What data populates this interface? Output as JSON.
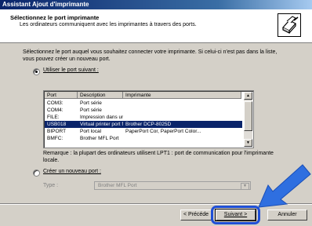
{
  "window": {
    "title": "Assistant Ajout d'imprimante"
  },
  "header": {
    "title": "Sélectionnez le port imprimante",
    "subtitle": "Les ordinateurs communiquent avec les imprimantes à travers des ports."
  },
  "instructions": "Sélectionnez le port auquel vous souhaitez connecter votre imprimante. Si celui-ci n'est pas dans la liste, vous pouvez créer un nouveau port.",
  "use_port": {
    "label": "Utiliser le port suivant :",
    "selected": true
  },
  "port_list": {
    "columns": [
      "Port",
      "Description",
      "Imprimante"
    ],
    "rows": [
      {
        "port": "COM3:",
        "description": "Port série",
        "printer": "",
        "selected": false
      },
      {
        "port": "COM4:",
        "description": "Port série",
        "printer": "",
        "selected": false
      },
      {
        "port": "FILE:",
        "description": "Impression dans un fi...",
        "printer": "",
        "selected": false
      },
      {
        "port": "USB018",
        "description": "Virtual printer port for ...",
        "printer": "Brother DCP-8025D",
        "selected": true
      },
      {
        "port": "BIPORT",
        "description": "Port local",
        "printer": "PaperPort Cor, PaperPort Color...",
        "selected": false
      },
      {
        "port": "BMFC:",
        "description": "Brother MFL Port",
        "printer": "",
        "selected": false
      }
    ]
  },
  "remark": "Remarque : la plupart des ordinateurs utilisent LPT1 : port de communication pour l'imprimante locale.",
  "new_port": {
    "label": "Créer un nouveau port :",
    "selected": false
  },
  "type_field": {
    "label": "Type :",
    "value": "Brother MFL Port"
  },
  "buttons": {
    "back": "< Précéde",
    "next": "Suivant >",
    "cancel": "Annuler"
  },
  "colors": {
    "titlebar": "#0a246a",
    "selection": "#0a246a",
    "annotation": "#1f4fd6"
  }
}
